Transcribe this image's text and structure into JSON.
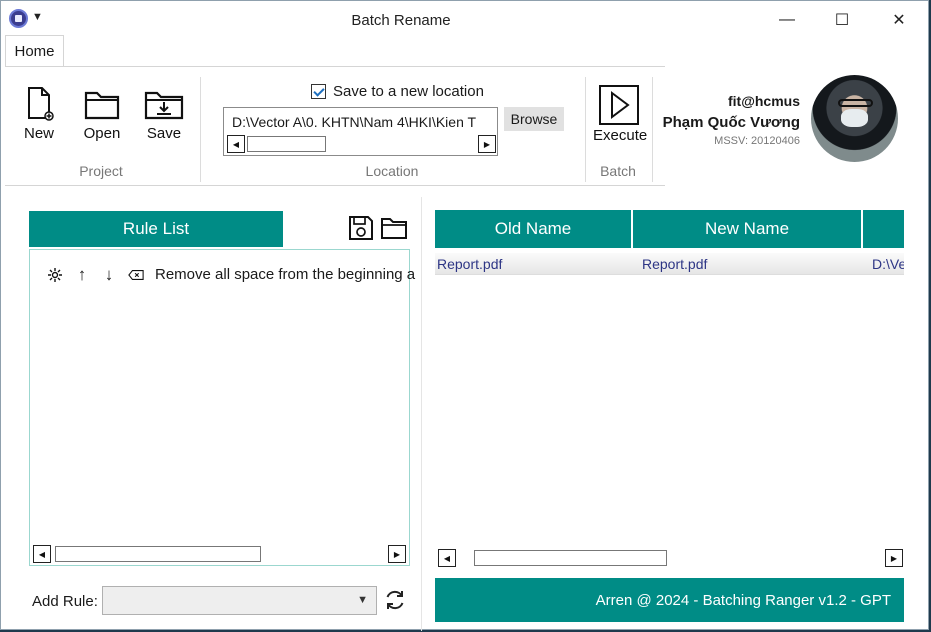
{
  "window": {
    "title": "Batch Rename",
    "minimize_glyph": "—",
    "maximize_glyph": "☐",
    "close_glyph": "✕"
  },
  "ribbon": {
    "tab": "Home",
    "project": {
      "group_label": "Project",
      "buttons": [
        {
          "label": "New",
          "icon": "new-file-icon"
        },
        {
          "label": "Open",
          "icon": "folder-icon"
        },
        {
          "label": "Save",
          "icon": "save-folder-icon"
        }
      ]
    },
    "location": {
      "group_label": "Location",
      "save_to_new_location_label": "Save to a new location",
      "save_to_new_location_checked": true,
      "path_value": "D:\\Vector A\\0. KHTN\\Nam 4\\HKI\\Kien T",
      "browse_label": "Browse"
    },
    "batch": {
      "group_label": "Batch",
      "execute_label": "Execute",
      "icon": "play-icon"
    }
  },
  "profile": {
    "username": "fit@hcmus",
    "full_name": "Phạm Quốc Vương",
    "student_id": "MSSV: 20120406"
  },
  "rules": {
    "header": "Rule List",
    "save_icon": "floppy-disk-icon",
    "open_icon": "folder-icon",
    "items": [
      {
        "label": "Remove all space from the beginning a",
        "icons": [
          "gear-icon",
          "arrow-up-icon",
          "arrow-down-icon",
          "remove-icon"
        ]
      }
    ],
    "add_rule_label": "Add Rule:",
    "add_rule_selected": "",
    "refresh_icon": "refresh-icon"
  },
  "files": {
    "columns": [
      "Old Name",
      "New Name",
      ""
    ],
    "rows": [
      {
        "old_name": "Report.pdf",
        "new_name": "Report.pdf",
        "path": "D:\\Ve"
      }
    ]
  },
  "footer": {
    "text": "Arren @ 2024 - Batching Ranger v1.2 - GPT"
  },
  "colors": {
    "accent": "#008c86",
    "link_text": "#2d3585",
    "rule_border": "#9bd7cf"
  }
}
